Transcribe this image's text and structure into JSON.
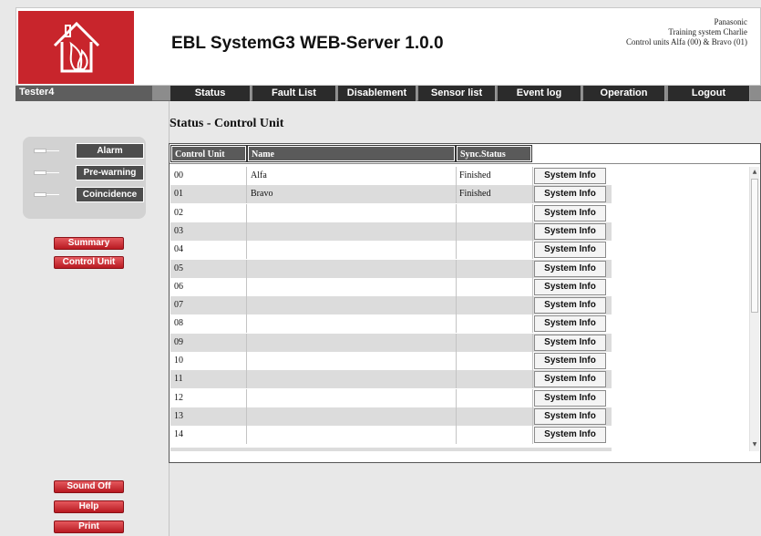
{
  "header": {
    "title": "EBL SystemG3 WEB-Server 1.0.0",
    "info_line1": "Panasonic",
    "info_line2": "Training system Charlie",
    "info_line3": "Control units Alfa (00) & Bravo (01)",
    "brand_color": "#c8252c"
  },
  "navbar": {
    "user": "Tester4",
    "items": [
      {
        "label": "Status"
      },
      {
        "label": "Fault List"
      },
      {
        "label": "Disablement"
      },
      {
        "label": "Sensor list"
      },
      {
        "label": "Event log"
      },
      {
        "label": "Operation"
      },
      {
        "label": "Logout"
      }
    ]
  },
  "indicators": [
    {
      "label": "Alarm"
    },
    {
      "label": "Pre-warning"
    },
    {
      "label": "Coincidence"
    }
  ],
  "side_buttons": {
    "summary": "Summary",
    "control_unit": "Control Unit",
    "sound_off": "Sound Off",
    "help": "Help",
    "print": "Print"
  },
  "main": {
    "title": "Status - Control Unit",
    "columns": [
      "Control Unit",
      "Name",
      "Sync.Status"
    ],
    "button_label": "System Info",
    "rows": [
      {
        "unit": "00",
        "name": "Alfa",
        "sync": "Finished"
      },
      {
        "unit": "01",
        "name": "Bravo",
        "sync": "Finished"
      },
      {
        "unit": "02",
        "name": "",
        "sync": ""
      },
      {
        "unit": "03",
        "name": "",
        "sync": ""
      },
      {
        "unit": "04",
        "name": "",
        "sync": ""
      },
      {
        "unit": "05",
        "name": "",
        "sync": ""
      },
      {
        "unit": "06",
        "name": "",
        "sync": ""
      },
      {
        "unit": "07",
        "name": "",
        "sync": ""
      },
      {
        "unit": "08",
        "name": "",
        "sync": ""
      },
      {
        "unit": "09",
        "name": "",
        "sync": ""
      },
      {
        "unit": "10",
        "name": "",
        "sync": ""
      },
      {
        "unit": "11",
        "name": "",
        "sync": ""
      },
      {
        "unit": "12",
        "name": "",
        "sync": ""
      },
      {
        "unit": "13",
        "name": "",
        "sync": ""
      },
      {
        "unit": "14",
        "name": "",
        "sync": ""
      }
    ]
  }
}
